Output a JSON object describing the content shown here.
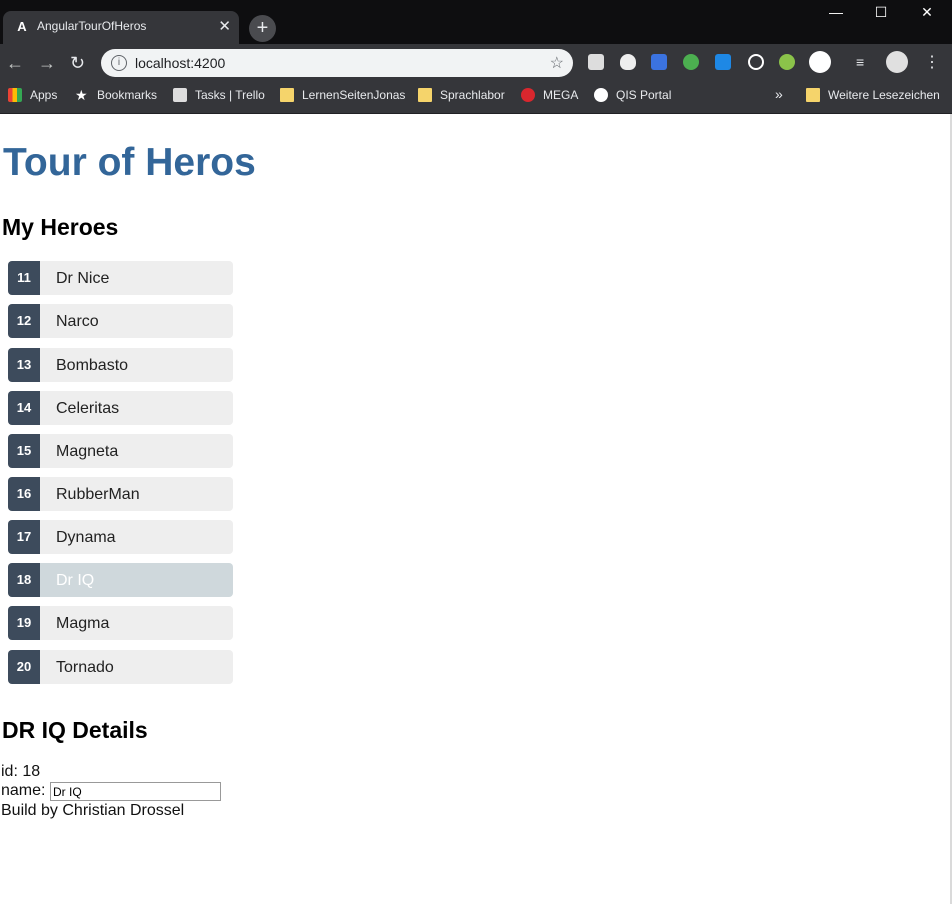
{
  "browser": {
    "tab_title": "AngularTourOfHeros",
    "tab_favicon": "A",
    "url": "localhost:4200",
    "bookmarks": [
      "Apps",
      "Bookmarks",
      "Tasks | Trello",
      "LernenSeitenJonas",
      "Sprachlabor",
      "MEGA",
      "QIS Portal"
    ],
    "more_bookmarks": "»",
    "other_bookmarks": "Weitere Lesezeichen"
  },
  "page": {
    "title": "Tour of Heros",
    "heroes_heading": "My Heroes",
    "heroes": [
      {
        "id": "11",
        "name": "Dr Nice"
      },
      {
        "id": "12",
        "name": "Narco"
      },
      {
        "id": "13",
        "name": "Bombasto"
      },
      {
        "id": "14",
        "name": "Celeritas"
      },
      {
        "id": "15",
        "name": "Magneta"
      },
      {
        "id": "16",
        "name": "RubberMan"
      },
      {
        "id": "17",
        "name": "Dynama"
      },
      {
        "id": "18",
        "name": "Dr IQ"
      },
      {
        "id": "19",
        "name": "Magma"
      },
      {
        "id": "20",
        "name": "Tornado"
      }
    ],
    "selected_id": "18",
    "details_heading": "DR IQ Details",
    "id_line": "id: 18",
    "name_label": "name:",
    "name_value": "Dr IQ",
    "footer": "Build by Christian Drossel"
  },
  "colors": {
    "title": "#336699",
    "badge": "#3d4b5c",
    "selected_bg": "#cfd8dc",
    "item_bg": "#eeeeee"
  }
}
